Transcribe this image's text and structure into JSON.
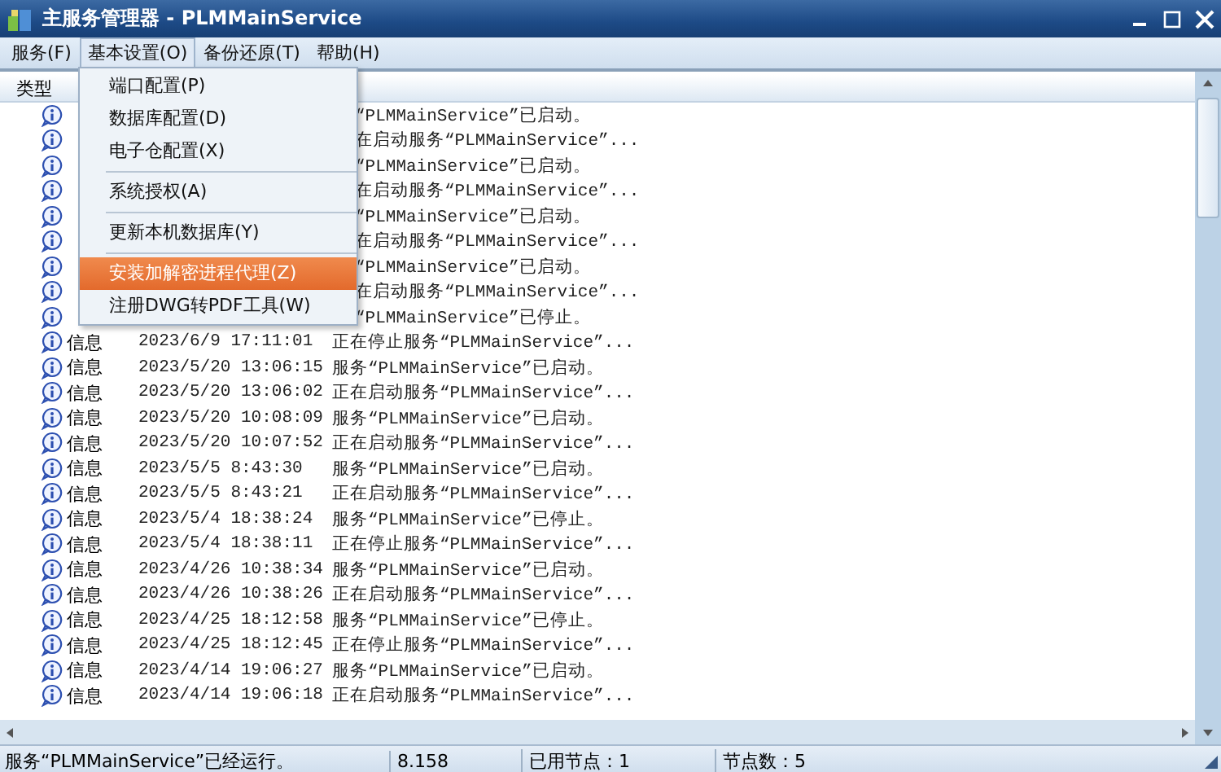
{
  "window": {
    "title": "主服务管理器 - PLMMainService"
  },
  "menu_bar": [
    {
      "label": "服务(F)",
      "selected": false
    },
    {
      "label": "基本设置(O)",
      "selected": true
    },
    {
      "label": "备份还原(T)",
      "selected": false
    },
    {
      "label": "帮助(H)",
      "selected": false
    }
  ],
  "dropdown": [
    {
      "kind": "item",
      "label": "端口配置(P)",
      "selected": false
    },
    {
      "kind": "item",
      "label": "数据库配置(D)",
      "selected": false
    },
    {
      "kind": "item",
      "label": "电子仓配置(X)",
      "selected": false
    },
    {
      "kind": "separator"
    },
    {
      "kind": "item",
      "label": "系统授权(A)",
      "selected": false
    },
    {
      "kind": "separator"
    },
    {
      "kind": "item",
      "label": "更新本机数据库(Y)",
      "selected": false
    },
    {
      "kind": "separator"
    },
    {
      "kind": "item",
      "label": "安装加解密进程代理(Z)",
      "selected": true
    },
    {
      "kind": "item",
      "label": "注册DWG转PDF工具(W)",
      "selected": false
    }
  ],
  "log": {
    "columns": [
      "类型"
    ],
    "rows": [
      {
        "kind": "covered",
        "message": "“PLMMainService”已启动。"
      },
      {
        "kind": "covered",
        "message": "在启动服务“PLMMainService”..."
      },
      {
        "kind": "covered",
        "message": "“PLMMainService”已启动。"
      },
      {
        "kind": "covered",
        "message": "在启动服务“PLMMainService”..."
      },
      {
        "kind": "covered",
        "message": "“PLMMainService”已启动。"
      },
      {
        "kind": "covered",
        "message": "在启动服务“PLMMainService”..."
      },
      {
        "kind": "covered",
        "message": "“PLMMainService”已启动。"
      },
      {
        "kind": "covered",
        "message": "在启动服务“PLMMainService”..."
      },
      {
        "kind": "covered",
        "message": "“PLMMainService”已停止。"
      },
      {
        "kind": "full",
        "type": "信息",
        "time": "2023/6/9 17:11:01",
        "message": "正在停止服务“PLMMainService”..."
      },
      {
        "kind": "full",
        "type": "信息",
        "time": "2023/5/20 13:06:15",
        "message": "服务“PLMMainService”已启动。"
      },
      {
        "kind": "full",
        "type": "信息",
        "time": "2023/5/20 13:06:02",
        "message": "正在启动服务“PLMMainService”..."
      },
      {
        "kind": "full",
        "type": "信息",
        "time": "2023/5/20 10:08:09",
        "message": "服务“PLMMainService”已启动。"
      },
      {
        "kind": "full",
        "type": "信息",
        "time": "2023/5/20 10:07:52",
        "message": "正在启动服务“PLMMainService”..."
      },
      {
        "kind": "full",
        "type": "信息",
        "time": "2023/5/5 8:43:30",
        "message": "服务“PLMMainService”已启动。"
      },
      {
        "kind": "full",
        "type": "信息",
        "time": "2023/5/5 8:43:21",
        "message": "正在启动服务“PLMMainService”..."
      },
      {
        "kind": "full",
        "type": "信息",
        "time": "2023/5/4 18:38:24",
        "message": "服务“PLMMainService”已停止。"
      },
      {
        "kind": "full",
        "type": "信息",
        "time": "2023/5/4 18:38:11",
        "message": "正在停止服务“PLMMainService”..."
      },
      {
        "kind": "full",
        "type": "信息",
        "time": "2023/4/26 10:38:34",
        "message": "服务“PLMMainService”已启动。"
      },
      {
        "kind": "full",
        "type": "信息",
        "time": "2023/4/26 10:38:26",
        "message": "正在启动服务“PLMMainService”..."
      },
      {
        "kind": "full",
        "type": "信息",
        "time": "2023/4/25 18:12:58",
        "message": "服务“PLMMainService”已停止。"
      },
      {
        "kind": "full",
        "type": "信息",
        "time": "2023/4/25 18:12:45",
        "message": "正在停止服务“PLMMainService”..."
      },
      {
        "kind": "full",
        "type": "信息",
        "time": "2023/4/14 19:06:27",
        "message": "服务“PLMMainService”已启动。"
      },
      {
        "kind": "full",
        "type": "信息",
        "time": "2023/4/14 19:06:18",
        "message": "正在启动服务“PLMMainService”..."
      }
    ]
  },
  "status_bar": [
    "服务“PLMMainService”已经运行。",
    "8.158",
    "已用节点：1",
    "节点数：5"
  ]
}
